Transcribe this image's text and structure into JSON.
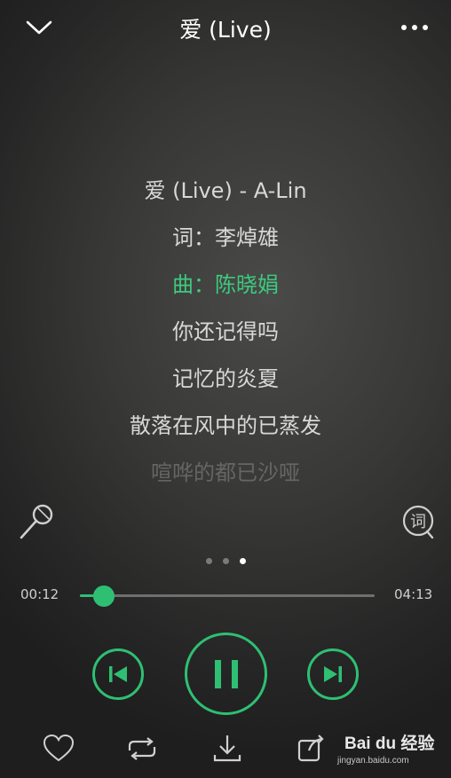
{
  "header": {
    "title": "爱 (Live)"
  },
  "lyrics": [
    "爱 (Live) - A-Lin",
    "词：李焯雄",
    "曲：陈晓娟",
    "你还记得吗",
    "记忆的炎夏",
    "散落在风中的已蒸发",
    "喧哗的都已沙哑"
  ],
  "lyrics_active_index": 2,
  "lyric_badge": "词",
  "pager": {
    "count": 3,
    "active": 2
  },
  "progress": {
    "current": "00:12",
    "total": "04:13",
    "fraction": 0.08
  },
  "watermark": {
    "brand": "Bai du 经验",
    "url": "jingyan.baidu.com"
  },
  "colors": {
    "accent": "#2fbf73",
    "active_lyric": "#3ccb7f"
  },
  "icons": {
    "collapse": "chevron-down-icon",
    "menu": "more-dots-icon",
    "mic": "microphone-icon",
    "lyric": "lyric-toggle-icon",
    "prev": "previous-icon",
    "pause": "pause-icon",
    "next": "next-icon",
    "like": "heart-icon",
    "repeat": "repeat-icon",
    "download": "download-icon",
    "share": "share-icon"
  }
}
